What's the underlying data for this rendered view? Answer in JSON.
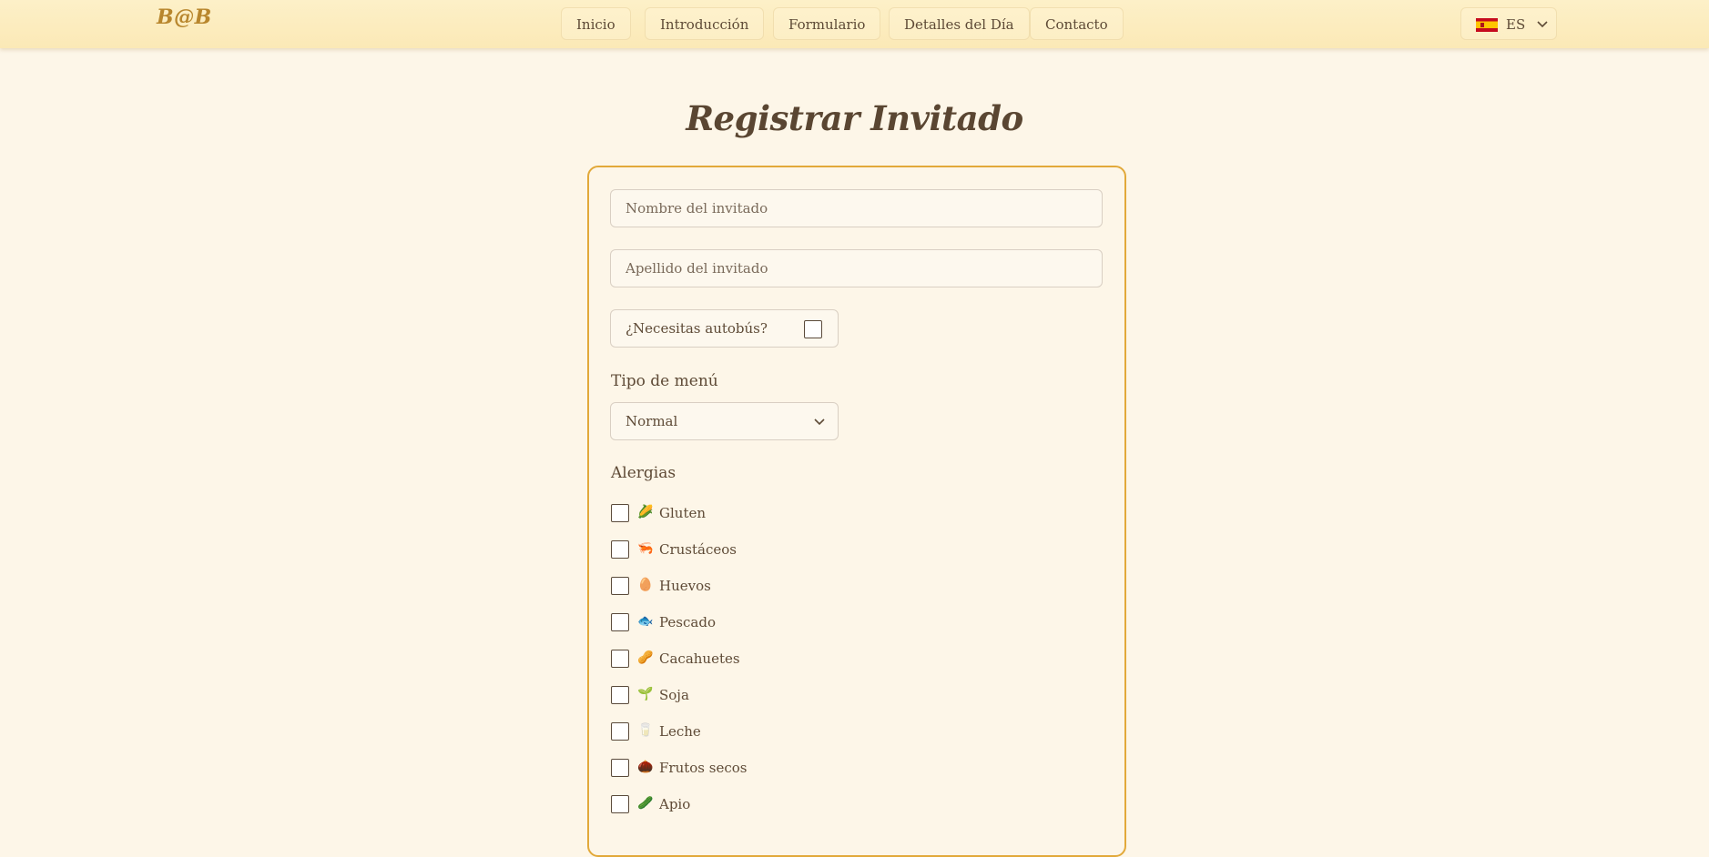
{
  "header": {
    "brand": "B@B",
    "nav": [
      {
        "id": "inicio",
        "label": "Inicio"
      },
      {
        "id": "introduccion",
        "label": "Introducción"
      },
      {
        "id": "formulario",
        "label": "Formulario"
      },
      {
        "id": "detalles",
        "label": "Detalles del Día"
      },
      {
        "id": "contacto",
        "label": "Contacto"
      }
    ],
    "language": {
      "code": "ES",
      "flag_icon": "spain-flag-icon"
    }
  },
  "form": {
    "title": "Registrar Invitado",
    "first_name_placeholder": "Nombre del invitado",
    "last_name_placeholder": "Apellido del invitado",
    "bus_label": "¿Necesitas autobús?",
    "bus_checked": false,
    "menu_label": "Tipo de menú",
    "menu_value": "Normal",
    "allergies_label": "Alergias",
    "allergies": [
      {
        "icon": "corn-icon",
        "glyph": "🌽",
        "label": "Gluten",
        "checked": false
      },
      {
        "icon": "shrimp-icon",
        "glyph": "🦐",
        "label": "Crustáceos",
        "checked": false
      },
      {
        "icon": "egg-icon",
        "glyph": "🥚",
        "label": "Huevos",
        "checked": false
      },
      {
        "icon": "fish-icon",
        "glyph": "🐟",
        "label": "Pescado",
        "checked": false
      },
      {
        "icon": "peanut-icon",
        "glyph": "🥜",
        "label": "Cacahuetes",
        "checked": false
      },
      {
        "icon": "sprout-icon",
        "glyph": "🌱",
        "label": "Soja",
        "checked": false
      },
      {
        "icon": "milk-glass-icon",
        "glyph": "🥛",
        "label": "Leche",
        "checked": false
      },
      {
        "icon": "chestnut-icon",
        "glyph": "🌰",
        "label": "Frutos secos",
        "checked": false
      },
      {
        "icon": "cucumber-icon",
        "glyph": "🥒",
        "label": "Apio",
        "checked": false
      }
    ]
  },
  "colors": {
    "accent": "#e2a93a",
    "brand": "#b8862d",
    "background": "#fdf6e8",
    "text": "#5a4a3a"
  }
}
